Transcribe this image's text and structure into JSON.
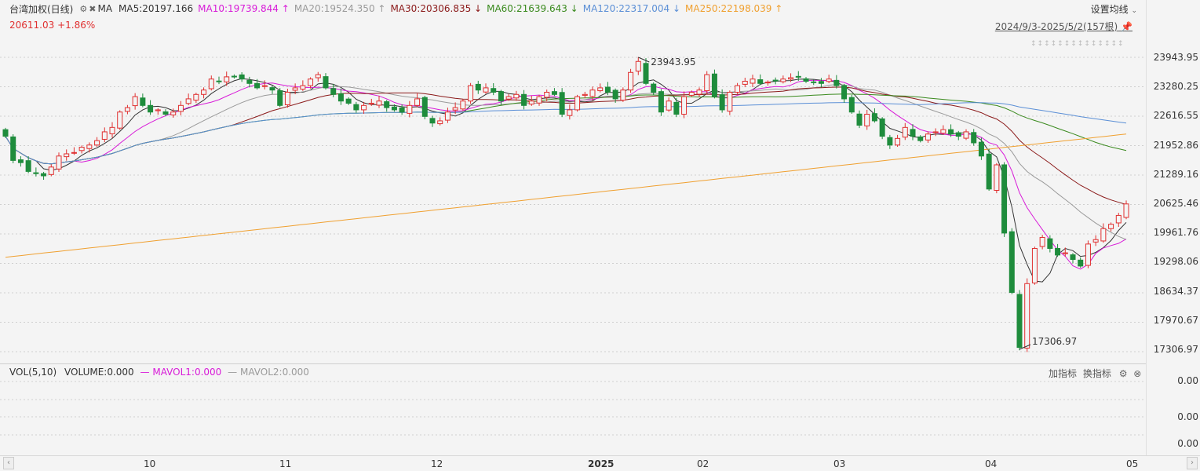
{
  "header": {
    "title": "台湾加权(日线)",
    "indicator": "MA",
    "ma": [
      {
        "label": "MA5:20197.166",
        "arrow": "",
        "color": "#333333"
      },
      {
        "label": "MA10:19739.844",
        "arrow": "↑",
        "color": "#d81bd8"
      },
      {
        "label": "MA20:19524.350",
        "arrow": "↑",
        "color": "#9a9a9a"
      },
      {
        "label": "MA30:20306.835",
        "arrow": "↓",
        "color": "#8b1a1a"
      },
      {
        "label": "MA60:21639.643",
        "arrow": "↓",
        "color": "#3a8a1e"
      },
      {
        "label": "MA120:22317.004",
        "arrow": "↓",
        "color": "#5b8fd6"
      },
      {
        "label": "MA250:22198.039",
        "arrow": "↑",
        "color": "#f0a030"
      }
    ],
    "price": "20611.03",
    "change": "+1.86%",
    "settings_label": "设置均线",
    "range_label": "2024/9/3-2025/5/2(157根)"
  },
  "volume_panel": {
    "title": "VOL(5,10)",
    "volume": "VOLUME:0.000",
    "mavol1": "MAVOL1:0.000",
    "mavol2": "MAVOL2:0.000",
    "add_indicator": "加指标",
    "switch_indicator": "换指标",
    "y_ticks": [
      "0.00",
      "0.00",
      "0.00"
    ]
  },
  "chart_data": {
    "type": "candlestick",
    "y_ticks": [
      "23943.95",
      "23280.25",
      "22616.55",
      "21952.86",
      "21289.16",
      "20625.46",
      "19961.76",
      "19298.06",
      "18634.37",
      "17970.67",
      "17306.97"
    ],
    "ylim": [
      17306.97,
      23943.95
    ],
    "x_ticks": [
      "10",
      "11",
      "12",
      "2025",
      "02",
      "03",
      "04",
      "05"
    ],
    "annotations": [
      {
        "text": "23943.95",
        "type": "high"
      },
      {
        "text": "17306.97",
        "type": "low"
      }
    ],
    "series": [
      {
        "name": "MA5",
        "color": "#333333"
      },
      {
        "name": "MA10",
        "color": "#d81bd8"
      },
      {
        "name": "MA20",
        "color": "#9a9a9a"
      },
      {
        "name": "MA30",
        "color": "#8b1a1a"
      },
      {
        "name": "MA60",
        "color": "#3a8a1e"
      },
      {
        "name": "MA120",
        "color": "#5b8fd6"
      },
      {
        "name": "MA250",
        "color": "#f0a030"
      }
    ],
    "candles_close": [
      22150,
      21600,
      21550,
      21350,
      21300,
      21250,
      21450,
      21700,
      21750,
      21780,
      21900,
      21950,
      22050,
      22250,
      22350,
      22700,
      22800,
      23050,
      22850,
      22700,
      22750,
      22650,
      22700,
      22850,
      23000,
      23100,
      23200,
      23450,
      23400,
      23500,
      23500,
      23450,
      23350,
      23250,
      23300,
      23200,
      22850,
      23150,
      23250,
      23300,
      23450,
      23550,
      23250,
      23100,
      22950,
      22900,
      22750,
      22850,
      22900,
      22950,
      22800,
      22750,
      22700,
      22850,
      23000,
      22600,
      22450,
      22500,
      22700,
      22800,
      22950,
      23300,
      23200,
      23250,
      23150,
      22950,
      23050,
      23100,
      22850,
      22950,
      23050,
      23150,
      23100,
      22650,
      22750,
      23050,
      23100,
      23200,
      23250,
      23150,
      23000,
      23200,
      23600,
      23850,
      23350,
      23150,
      22700,
      22950,
      22650,
      23050,
      23150,
      23200,
      23550,
      23050,
      22750,
      23150,
      23300,
      23400,
      23450,
      23350,
      23380,
      23420,
      23450,
      23480,
      23500,
      23400,
      23380,
      23350,
      23450,
      23300,
      23000,
      22700,
      22400,
      22650,
      22500,
      22150,
      21950,
      22100,
      22350,
      22150,
      22050,
      22200,
      22250,
      22300,
      22200,
      22150,
      22250,
      22000,
      21700,
      20950,
      21500,
      19950,
      18600,
      17350,
      18800,
      19600,
      19850,
      19600,
      19450,
      19500,
      19350,
      19200,
      19700,
      19800,
      20050,
      20150,
      20350,
      20611
    ]
  }
}
